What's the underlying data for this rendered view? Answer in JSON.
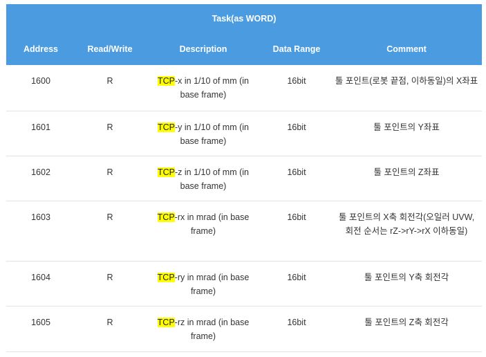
{
  "table": {
    "title": "Task(as WORD)",
    "headers": [
      "Address",
      "Read/Write",
      "Description",
      "Data Range",
      "Comment"
    ],
    "highlight_color": "#ffff00",
    "header_color": "#4a9be0",
    "rows": [
      {
        "address": "1600",
        "rw": "R",
        "tcp": "TCP",
        "desc": "-x in 1/10 of mm (in base frame)",
        "range": "16bit",
        "comment": "툴 포인트(로봇 끝점, 이하동일)의 X좌표"
      },
      {
        "address": "1601",
        "rw": "R",
        "tcp": "TCP",
        "desc": "-y in 1/10 of mm (in base frame)",
        "range": "16bit",
        "comment": "툴 포인트의 Y좌표"
      },
      {
        "address": "1602",
        "rw": "R",
        "tcp": "TCP",
        "desc": "-z in 1/10 of mm (in base frame)",
        "range": "16bit",
        "comment": "툴 포인트의 Z좌표"
      },
      {
        "address": "1603",
        "rw": "R",
        "tcp": "TCP",
        "desc": "-rx in mrad (in base frame)",
        "range": "16bit",
        "comment": "툴 포인트의 X축 회전각(오일러 UVW, 회전 순서는 rZ->rY->rX 이하동일)"
      },
      {
        "address": "1604",
        "rw": "R",
        "tcp": "TCP",
        "desc": "-ry in mrad (in base frame)",
        "range": "16bit",
        "comment": "툴 포인트의 Y축 회전각"
      },
      {
        "address": "1605",
        "rw": "R",
        "tcp": "TCP",
        "desc": "-rz in mrad (in base frame)",
        "range": "16bit",
        "comment": "툴 포인트의 Z축 회전각"
      }
    ]
  }
}
